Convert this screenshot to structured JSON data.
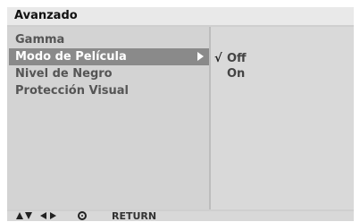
{
  "header": {
    "title": "Avanzado"
  },
  "menu": {
    "items": [
      {
        "label": "Gamma"
      },
      {
        "label": "Modo de Película",
        "selected": true,
        "has_submenu": true
      },
      {
        "label": "Nivel de Negro"
      },
      {
        "label": "Protección Visual"
      }
    ]
  },
  "submenu": {
    "options": [
      {
        "label": "Off",
        "checked": true,
        "check_mark": "√"
      },
      {
        "label": "On",
        "checked": false
      }
    ]
  },
  "footer": {
    "icons": [
      "up-down-arrows-icon",
      "left-right-arrows-icon",
      "ok-icon"
    ],
    "return_label": "RETURN"
  },
  "colors": {
    "panel": "#d0d0d0",
    "title_bar": "#e9e9e9",
    "selection": "#8a8a8a",
    "submenu_bg": "#d9d9d9"
  }
}
